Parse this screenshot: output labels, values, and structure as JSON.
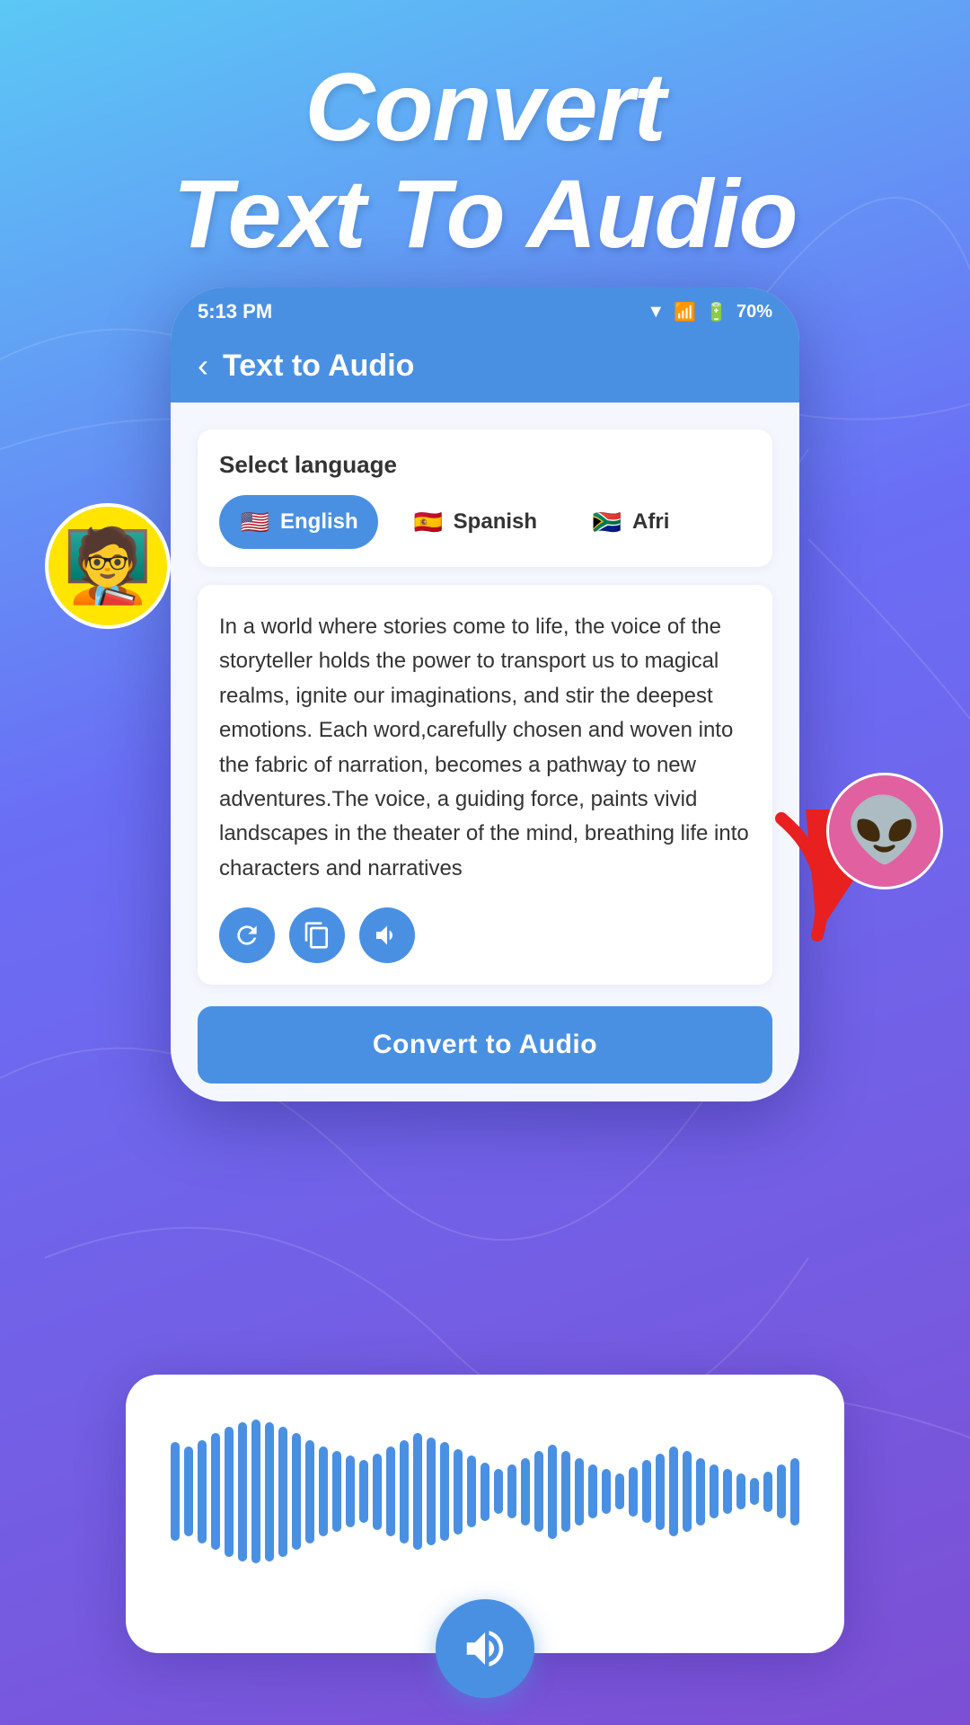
{
  "hero": {
    "line1": "Convert",
    "line2": "Text To Audio"
  },
  "status_bar": {
    "time": "5:13 PM",
    "battery": "70%"
  },
  "app_header": {
    "title": "Text to Audio",
    "back_label": "‹"
  },
  "language_section": {
    "label": "Select language",
    "languages": [
      {
        "name": "English",
        "flag": "🇺🇸",
        "active": true
      },
      {
        "name": "Spanish",
        "flag": "🇪🇸",
        "active": false
      },
      {
        "name": "Afri",
        "flag": "🇿🇦",
        "active": false
      }
    ]
  },
  "text_content": "In a world where stories come to life, the voice of the storyteller holds the power to transport us to magical realms, ignite our imaginations, and stir the deepest emotions. Each word,carefully chosen and woven into the fabric of narration, becomes a pathway to new adventures.The voice, a guiding force, paints vivid landscapes in the theater of the mind, breathing life into characters and narratives",
  "convert_button": {
    "label": "Convert to Audio"
  },
  "action_buttons": {
    "refresh": "refresh",
    "copy": "copy",
    "volume": "volume"
  }
}
